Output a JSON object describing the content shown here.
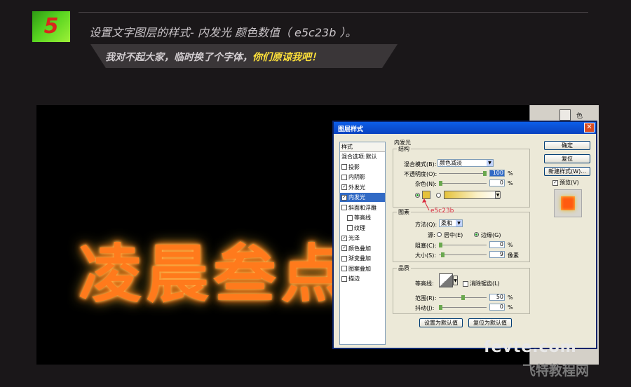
{
  "step": {
    "number": "5"
  },
  "heading": "设置文字图层的样式- 内发光 颜色数值（ e5c23b ）。",
  "banner": {
    "text_a": "我对不起大家，临时换了个字体，",
    "text_b": "你们原谅我吧！"
  },
  "canvas": {
    "glow_text": "凌晨叁点"
  },
  "ps_panel": {
    "label": "色"
  },
  "dialog": {
    "title": "图层样式",
    "close": "✕",
    "styles_header": "样式",
    "styles": [
      {
        "label": "混合选项:默认",
        "checkbox": false,
        "checked": false,
        "selected": false
      },
      {
        "label": "投影",
        "checkbox": true,
        "checked": false,
        "selected": false
      },
      {
        "label": "内阴影",
        "checkbox": true,
        "checked": false,
        "selected": false
      },
      {
        "label": "外发光",
        "checkbox": true,
        "checked": true,
        "selected": false
      },
      {
        "label": "内发光",
        "checkbox": true,
        "checked": true,
        "selected": true
      },
      {
        "label": "斜面和浮雕",
        "checkbox": true,
        "checked": false,
        "selected": false
      },
      {
        "label": "等高线",
        "checkbox": true,
        "checked": false,
        "selected": false
      },
      {
        "label": "纹理",
        "checkbox": true,
        "checked": false,
        "selected": false
      },
      {
        "label": "光泽",
        "checkbox": true,
        "checked": true,
        "selected": false
      },
      {
        "label": "颜色叠加",
        "checkbox": true,
        "checked": true,
        "selected": false
      },
      {
        "label": "渐变叠加",
        "checkbox": true,
        "checked": false,
        "selected": false
      },
      {
        "label": "图案叠加",
        "checkbox": true,
        "checked": false,
        "selected": false
      },
      {
        "label": "描边",
        "checkbox": true,
        "checked": false,
        "selected": false
      }
    ],
    "inner_glow": {
      "section": "内发光",
      "structure": {
        "group": "结构",
        "blend_mode_label": "混合模式(B):",
        "blend_mode_value": "颜色减淡",
        "opacity_label": "不透明度(O):",
        "opacity_value": "100",
        "opacity_fraction": 1.0,
        "noise_label": "杂色(N):",
        "noise_value": "0",
        "noise_fraction": 0.0,
        "percent": "%",
        "glow_color": "#e5c23b"
      },
      "elements": {
        "group": "图素",
        "technique_label": "方法(Q):",
        "technique_value": "柔和",
        "source_label": "源:",
        "source_center": "居中(E)",
        "source_edge": "边缘(G)",
        "choke_label": "阻塞(C):",
        "choke_value": "0",
        "choke_fraction": 0.0,
        "size_label": "大小(S):",
        "size_value": "9",
        "size_fraction": 0.04,
        "percent": "%",
        "px": "像素"
      },
      "quality": {
        "group": "品质",
        "contour_label": "等高线:",
        "anti_alias_label": "消除锯齿(L)",
        "range_label": "范围(R):",
        "range_value": "50",
        "range_fraction": 0.5,
        "jitter_label": "抖动(J):",
        "jitter_value": "0",
        "jitter_fraction": 0.0,
        "percent": "%"
      },
      "make_default": "设置为默认值",
      "reset_default": "复位为默认值"
    },
    "buttons": {
      "ok": "确定",
      "reset": "复位",
      "new_style": "新建样式(W)...",
      "preview": "预览(V)"
    }
  },
  "annotation": {
    "color_code": "e5c23b"
  },
  "watermark": {
    "line1": "fevte.com",
    "line2": "飞特教程网"
  }
}
